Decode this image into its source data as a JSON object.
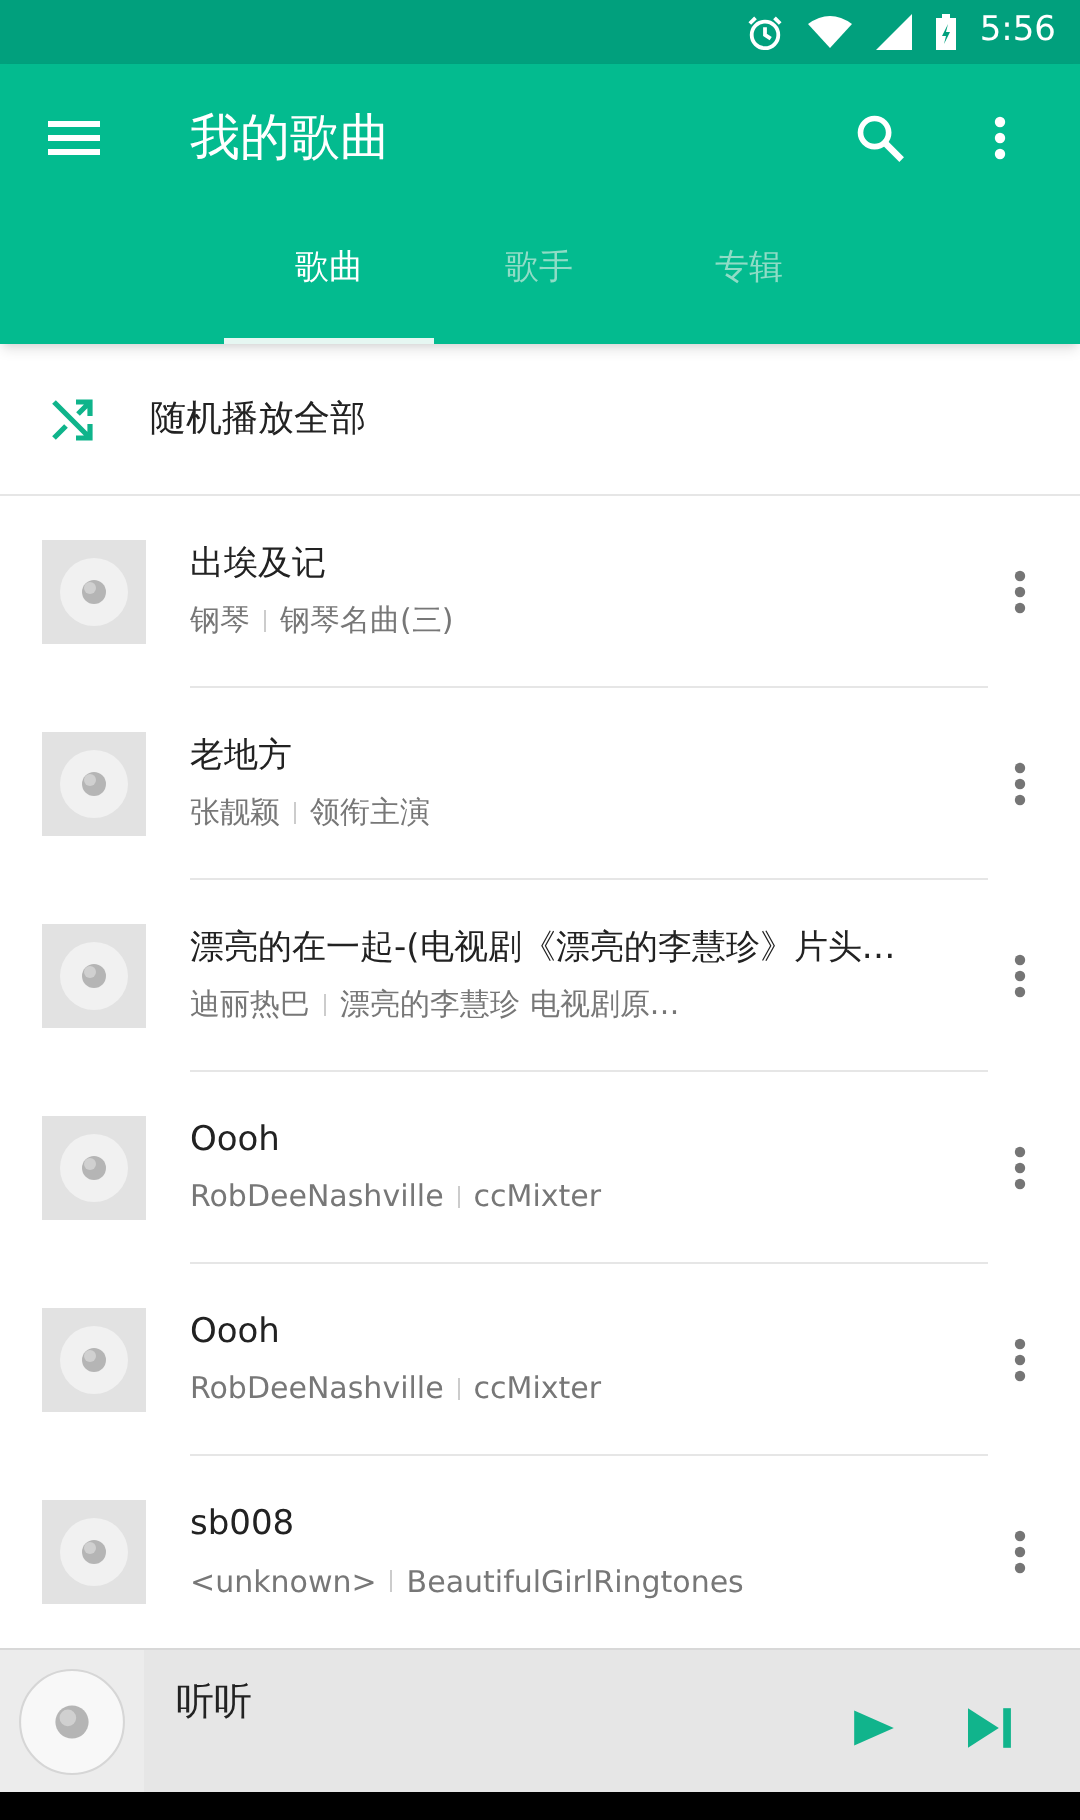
{
  "status_bar": {
    "time": "5:56"
  },
  "app_bar": {
    "title": "我的歌曲"
  },
  "tabs": [
    {
      "label": "歌曲",
      "selected": true
    },
    {
      "label": "歌手",
      "selected": false
    },
    {
      "label": "专辑",
      "selected": false
    }
  ],
  "shuffle": {
    "label": "随机播放全部"
  },
  "songs": [
    {
      "title": "出埃及记",
      "artist": "钢琴",
      "album": "钢琴名曲(三)"
    },
    {
      "title": "老地方",
      "artist": "张靓颖",
      "album": "领衔主演"
    },
    {
      "title": "漂亮的在一起-(电视剧《漂亮的李慧珍》片头…",
      "artist": "迪丽热巴",
      "album": "漂亮的李慧珍 电视剧原…"
    },
    {
      "title": "Oooh",
      "artist": "RobDeeNashville",
      "album": "ccMixter"
    },
    {
      "title": "Oooh",
      "artist": "RobDeeNashville",
      "album": "ccMixter"
    },
    {
      "title": "sb008",
      "artist": "<unknown>",
      "album": "BeautifulGirlRingtones"
    }
  ],
  "now_playing": {
    "title": "听听"
  }
}
